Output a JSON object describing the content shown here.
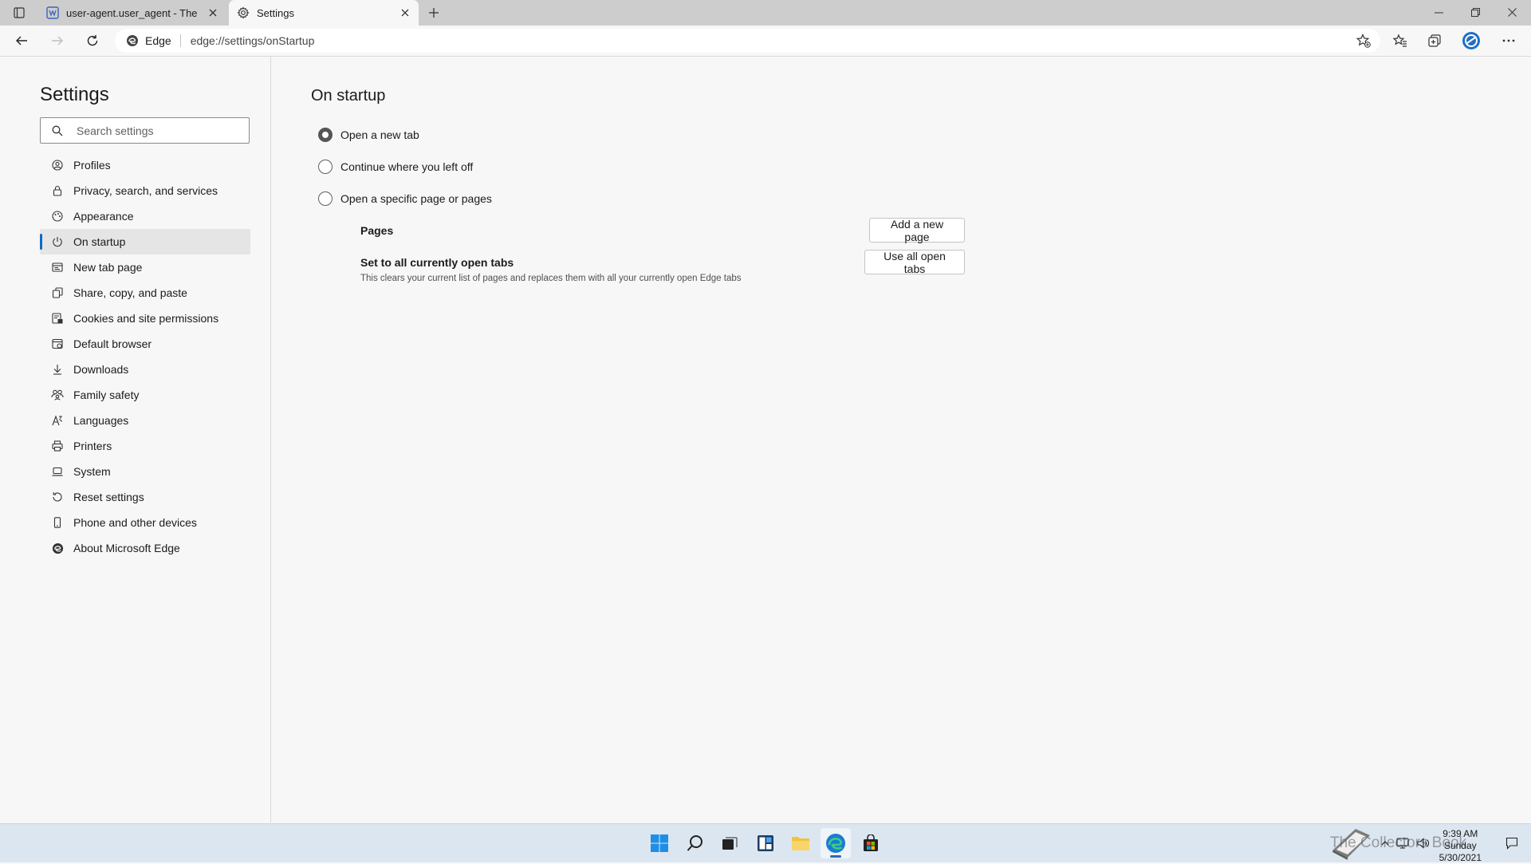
{
  "tabs": [
    {
      "title": "user-agent.user_agent - The Coll",
      "active": false
    },
    {
      "title": "Settings",
      "active": true
    }
  ],
  "toolbar": {
    "site_label": "Edge",
    "url": "edge://settings/onStartup"
  },
  "sidebar": {
    "title": "Settings",
    "search_placeholder": "Search settings",
    "items": [
      {
        "label": "Profiles",
        "icon": "profile-icon"
      },
      {
        "label": "Privacy, search, and services",
        "icon": "lock-icon"
      },
      {
        "label": "Appearance",
        "icon": "appearance-icon"
      },
      {
        "label": "On startup",
        "icon": "power-icon",
        "active": true
      },
      {
        "label": "New tab page",
        "icon": "new-tab-icon"
      },
      {
        "label": "Share, copy, and paste",
        "icon": "share-icon"
      },
      {
        "label": "Cookies and site permissions",
        "icon": "cookies-icon"
      },
      {
        "label": "Default browser",
        "icon": "default-browser-icon"
      },
      {
        "label": "Downloads",
        "icon": "download-icon"
      },
      {
        "label": "Family safety",
        "icon": "family-icon"
      },
      {
        "label": "Languages",
        "icon": "languages-icon"
      },
      {
        "label": "Printers",
        "icon": "printer-icon"
      },
      {
        "label": "System",
        "icon": "system-icon"
      },
      {
        "label": "Reset settings",
        "icon": "reset-icon"
      },
      {
        "label": "Phone and other devices",
        "icon": "phone-icon"
      },
      {
        "label": "About Microsoft Edge",
        "icon": "edge-icon"
      }
    ]
  },
  "main": {
    "title": "On startup",
    "options": [
      {
        "label": "Open a new tab",
        "checked": true
      },
      {
        "label": "Continue where you left off",
        "checked": false
      },
      {
        "label": "Open a specific page or pages",
        "checked": false
      }
    ],
    "pages_label": "Pages",
    "add_page_button": "Add a new page",
    "set_all_title": "Set to all currently open tabs",
    "set_all_desc": "This clears your current list of pages and replaces them with all your currently open Edge tabs",
    "use_all_button": "Use all open tabs"
  },
  "taskbar": {
    "time": "9:39 AM",
    "day": "Sunday",
    "date": "5/30/2021",
    "watermark": "The Collectors Book"
  },
  "colors": {
    "accent": "#0f6cbd",
    "tabstrip": "#cdcdcd",
    "background": "#f7f7f7",
    "taskbar": "#dce6f0"
  }
}
